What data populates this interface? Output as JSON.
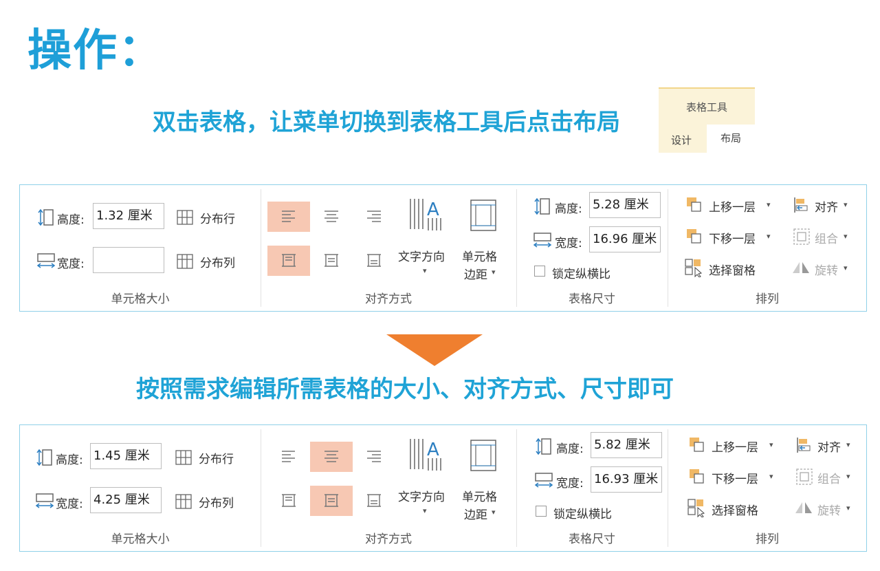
{
  "heading": "操作：",
  "instruction_1": "双击表格，让菜单切换到表格工具后点击布局",
  "instruction_2": "按照需求编辑所需表格的大小、对齐方式、尺寸即可",
  "context_tabs": {
    "group_title": "表格工具",
    "tab_design": "设计",
    "tab_layout": "布局"
  },
  "colors": {
    "accent": "#1fa3d6",
    "selected": "#f7c8b3",
    "arrow": "#ef7f2f",
    "ribbon_border": "#8fd0e8"
  },
  "ribbon_before": {
    "cell_size": {
      "height_label": "高度:",
      "height_value": "1.32 厘米",
      "width_label": "宽度:",
      "width_value": "",
      "distribute_rows": "分布行",
      "distribute_cols": "分布列",
      "group_label": "单元格大小"
    },
    "alignment": {
      "text_direction": "文字方向",
      "cell_margins_l1": "单元格",
      "cell_margins_l2": "边距",
      "group_label": "对齐方式",
      "selected_horizontal": "left",
      "selected_vertical": "top"
    },
    "table_size": {
      "height_label": "高度:",
      "height_value": "5.28 厘米",
      "width_label": "宽度:",
      "width_value": "16.96 厘米",
      "lock_ratio": "锁定纵横比",
      "group_label": "表格尺寸"
    },
    "arrange": {
      "bring_forward": "上移一层",
      "send_backward": "下移一层",
      "selection_pane": "选择窗格",
      "align": "对齐",
      "group": "组合",
      "rotate": "旋转",
      "group_label": "排列"
    }
  },
  "ribbon_after": {
    "cell_size": {
      "height_label": "高度:",
      "height_value": "1.45 厘米",
      "width_label": "宽度:",
      "width_value": "4.25 厘米",
      "distribute_rows": "分布行",
      "distribute_cols": "分布列",
      "group_label": "单元格大小"
    },
    "alignment": {
      "text_direction": "文字方向",
      "cell_margins_l1": "单元格",
      "cell_margins_l2": "边距",
      "group_label": "对齐方式",
      "selected_horizontal": "center",
      "selected_vertical": "middle"
    },
    "table_size": {
      "height_label": "高度:",
      "height_value": "5.82 厘米",
      "width_label": "宽度:",
      "width_value": "16.93 厘米",
      "lock_ratio": "锁定纵横比",
      "group_label": "表格尺寸"
    },
    "arrange": {
      "bring_forward": "上移一层",
      "send_backward": "下移一层",
      "selection_pane": "选择窗格",
      "align": "对齐",
      "group": "组合",
      "rotate": "旋转",
      "group_label": "排列"
    }
  }
}
